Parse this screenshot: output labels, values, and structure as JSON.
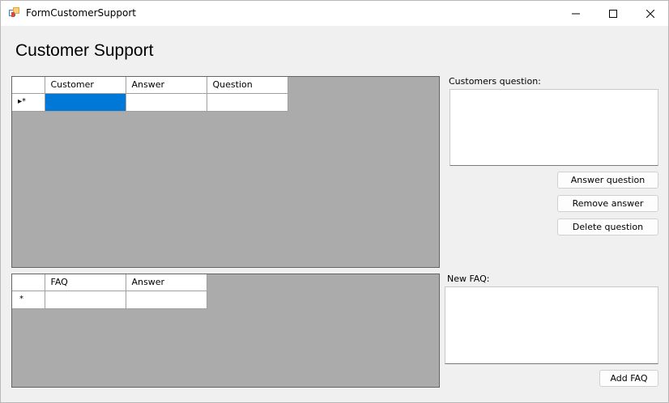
{
  "window": {
    "title": "FormCustomerSupport"
  },
  "page": {
    "title": "Customer Support"
  },
  "questions_grid": {
    "columns": [
      "Customer",
      "Answer",
      "Question"
    ],
    "new_row_indicator": "▸*",
    "rows": [
      {
        "customer": "",
        "answer": "",
        "question": ""
      }
    ]
  },
  "faq_grid": {
    "columns": [
      "FAQ",
      "Answer"
    ],
    "new_row_indicator": "*",
    "rows": [
      {
        "faq": "",
        "answer": ""
      }
    ]
  },
  "customers_question": {
    "label": "Customers question:",
    "value": ""
  },
  "buttons": {
    "answer_question": "Answer question",
    "remove_answer": "Remove answer",
    "delete_question": "Delete question",
    "add_faq": "Add FAQ"
  },
  "new_faq": {
    "label": "New FAQ:",
    "value": ""
  },
  "colors": {
    "selection": "#0078d7",
    "grid_background": "#ababab",
    "form_background": "#f0f0f0"
  },
  "icons": [
    "app-form-icon",
    "minimize-icon",
    "maximize-icon",
    "close-icon"
  ]
}
